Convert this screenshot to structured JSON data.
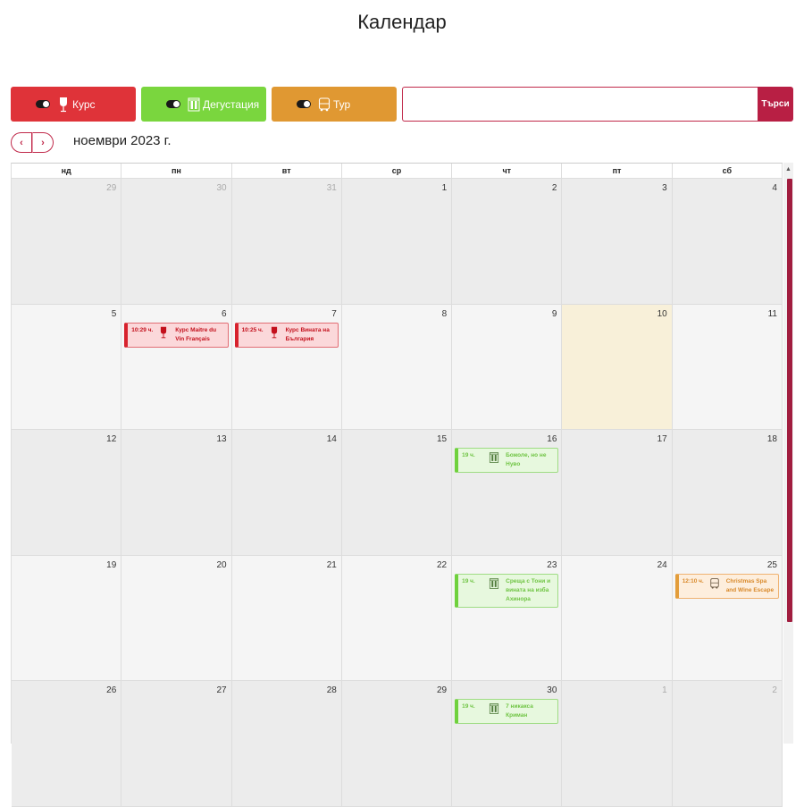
{
  "page": {
    "title": "Календар"
  },
  "filters": [
    {
      "label": "Курс",
      "color": "#df3339",
      "icon": "wine-glass-icon"
    },
    {
      "label": "Дегустация",
      "color": "#7ad63e",
      "icon": "wine-bottles-icon"
    },
    {
      "label": "Тур",
      "color": "#e09832",
      "icon": "bus-icon"
    }
  ],
  "search": {
    "value": "",
    "placeholder": "",
    "button_label": "Търси"
  },
  "nav": {
    "prev_icon": "chevron-left-icon",
    "next_icon": "chevron-right-icon",
    "prev_glyph": "‹",
    "next_glyph": "›"
  },
  "month_title": "ноември 2023 г.",
  "weekdays": [
    "нд",
    "пн",
    "вт",
    "ср",
    "чт",
    "пт",
    "сб"
  ],
  "weeks": [
    [
      {
        "num": "29",
        "other": true
      },
      {
        "num": "30",
        "other": true
      },
      {
        "num": "31",
        "other": true
      },
      {
        "num": "1"
      },
      {
        "num": "2"
      },
      {
        "num": "3"
      },
      {
        "num": "4"
      }
    ],
    [
      {
        "num": "5"
      },
      {
        "num": "6",
        "events": [
          {
            "type": "red",
            "time": "10:29 ч.",
            "icon": "wine-glass-icon",
            "title": "Курс Maitre du Vin Français"
          }
        ]
      },
      {
        "num": "7",
        "events": [
          {
            "type": "red",
            "time": "10:25 ч.",
            "icon": "wine-glass-icon",
            "title": "Курс Вината на България"
          }
        ]
      },
      {
        "num": "8"
      },
      {
        "num": "9"
      },
      {
        "num": "10",
        "today": true
      },
      {
        "num": "11"
      }
    ],
    [
      {
        "num": "12"
      },
      {
        "num": "13"
      },
      {
        "num": "14"
      },
      {
        "num": "15"
      },
      {
        "num": "16",
        "events": [
          {
            "type": "green",
            "time": "19 ч.",
            "icon": "wine-bottles-icon",
            "title": "Божоле, но не Нуво"
          }
        ]
      },
      {
        "num": "17"
      },
      {
        "num": "18"
      }
    ],
    [
      {
        "num": "19"
      },
      {
        "num": "20"
      },
      {
        "num": "21"
      },
      {
        "num": "22"
      },
      {
        "num": "23",
        "events": [
          {
            "type": "green",
            "time": "19 ч.",
            "icon": "wine-bottles-icon",
            "title": "Среща с Тони и вината на изба Ахинора"
          }
        ]
      },
      {
        "num": "24"
      },
      {
        "num": "25",
        "events": [
          {
            "type": "orange",
            "time": "12:10 ч.",
            "icon": "bus-icon",
            "title": "Christmas Spa and Wine Escape"
          }
        ]
      }
    ],
    [
      {
        "num": "26"
      },
      {
        "num": "27"
      },
      {
        "num": "28"
      },
      {
        "num": "29"
      },
      {
        "num": "30",
        "events": [
          {
            "type": "green",
            "time": "19 ч.",
            "icon": "wine-bottles-icon",
            "title": "7 никакса Криман"
          }
        ]
      },
      {
        "num": "1",
        "other": true
      },
      {
        "num": "2",
        "other": true
      }
    ]
  ],
  "colors": {
    "accent": "#b81f44",
    "today_bg": "#f8f0d9",
    "row_shade": "#ececec",
    "row_light": "#f5f5f5"
  }
}
